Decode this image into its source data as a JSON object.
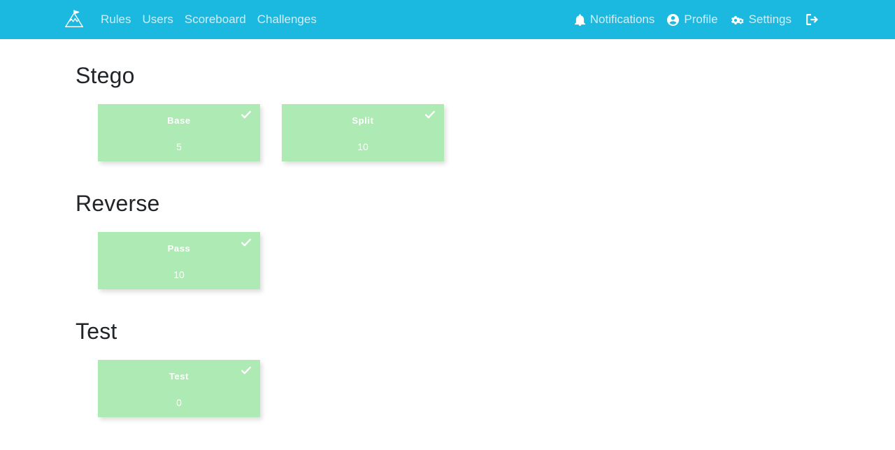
{
  "colors": {
    "navbar_bg": "#1bb8e0",
    "nav_text": "#ffffff",
    "card_solved_bg": "#aeeab3",
    "card_text": "#ffffff",
    "heading_text": "#212529",
    "page_bg": "#ffffff"
  },
  "navbar": {
    "brand_icon": "mountain-flag-logo",
    "left_links": [
      {
        "label": "Rules",
        "icon": null
      },
      {
        "label": "Users",
        "icon": null
      },
      {
        "label": "Scoreboard",
        "icon": null
      },
      {
        "label": "Challenges",
        "icon": null
      }
    ],
    "right_links": [
      {
        "label": "Notifications",
        "icon": "bell-icon"
      },
      {
        "label": "Profile",
        "icon": "user-circle-icon"
      },
      {
        "label": "Settings",
        "icon": "cogs-icon"
      },
      {
        "label": "",
        "icon": "sign-out-icon"
      }
    ]
  },
  "categories": [
    {
      "title": "Stego",
      "challenges": [
        {
          "name": "Base",
          "value": "5",
          "solved": true,
          "solved_icon": "check-icon"
        },
        {
          "name": "Split",
          "value": "10",
          "solved": true,
          "solved_icon": "check-icon"
        }
      ]
    },
    {
      "title": "Reverse",
      "challenges": [
        {
          "name": "Pass",
          "value": "10",
          "solved": true,
          "solved_icon": "check-icon"
        }
      ]
    },
    {
      "title": "Test",
      "challenges": [
        {
          "name": "Test",
          "value": "0",
          "solved": true,
          "solved_icon": "check-icon"
        }
      ]
    }
  ]
}
